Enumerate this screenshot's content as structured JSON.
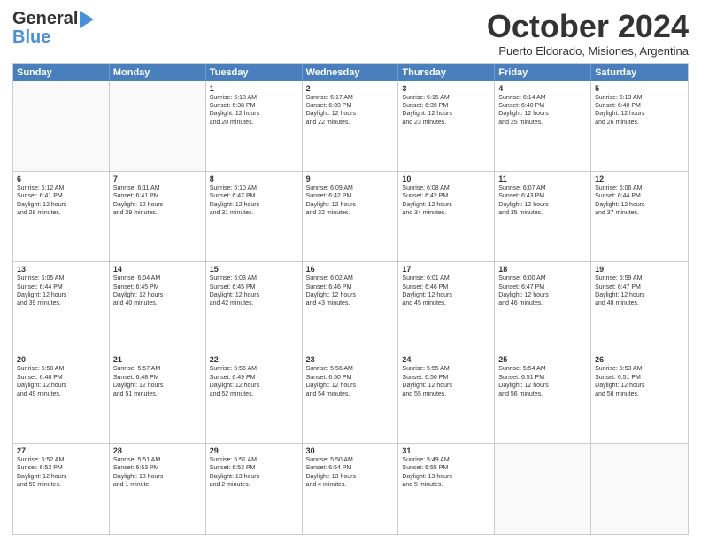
{
  "header": {
    "logo_line1": "General",
    "logo_line2": "Blue",
    "month_title": "October 2024",
    "subtitle": "Puerto Eldorado, Misiones, Argentina"
  },
  "days_of_week": [
    "Sunday",
    "Monday",
    "Tuesday",
    "Wednesday",
    "Thursday",
    "Friday",
    "Saturday"
  ],
  "weeks": [
    [
      {
        "day": "",
        "empty": true
      },
      {
        "day": "",
        "empty": true
      },
      {
        "day": "1",
        "sunrise": "6:18 AM",
        "sunset": "6:38 PM",
        "daylight": "12 hours and 20 minutes."
      },
      {
        "day": "2",
        "sunrise": "6:17 AM",
        "sunset": "6:39 PM",
        "daylight": "12 hours and 22 minutes."
      },
      {
        "day": "3",
        "sunrise": "6:15 AM",
        "sunset": "6:39 PM",
        "daylight": "12 hours and 23 minutes."
      },
      {
        "day": "4",
        "sunrise": "6:14 AM",
        "sunset": "6:40 PM",
        "daylight": "12 hours and 25 minutes."
      },
      {
        "day": "5",
        "sunrise": "6:13 AM",
        "sunset": "6:40 PM",
        "daylight": "12 hours and 26 minutes."
      }
    ],
    [
      {
        "day": "6",
        "sunrise": "6:12 AM",
        "sunset": "6:41 PM",
        "daylight": "12 hours and 28 minutes."
      },
      {
        "day": "7",
        "sunrise": "6:11 AM",
        "sunset": "6:41 PM",
        "daylight": "12 hours and 29 minutes."
      },
      {
        "day": "8",
        "sunrise": "6:10 AM",
        "sunset": "6:42 PM",
        "daylight": "12 hours and 31 minutes."
      },
      {
        "day": "9",
        "sunrise": "6:09 AM",
        "sunset": "6:42 PM",
        "daylight": "12 hours and 32 minutes."
      },
      {
        "day": "10",
        "sunrise": "6:08 AM",
        "sunset": "6:42 PM",
        "daylight": "12 hours and 34 minutes."
      },
      {
        "day": "11",
        "sunrise": "6:07 AM",
        "sunset": "6:43 PM",
        "daylight": "12 hours and 35 minutes."
      },
      {
        "day": "12",
        "sunrise": "6:06 AM",
        "sunset": "6:44 PM",
        "daylight": "12 hours and 37 minutes."
      }
    ],
    [
      {
        "day": "13",
        "sunrise": "6:05 AM",
        "sunset": "6:44 PM",
        "daylight": "12 hours and 39 minutes."
      },
      {
        "day": "14",
        "sunrise": "6:04 AM",
        "sunset": "6:45 PM",
        "daylight": "12 hours and 40 minutes."
      },
      {
        "day": "15",
        "sunrise": "6:03 AM",
        "sunset": "6:45 PM",
        "daylight": "12 hours and 42 minutes."
      },
      {
        "day": "16",
        "sunrise": "6:02 AM",
        "sunset": "6:46 PM",
        "daylight": "12 hours and 43 minutes."
      },
      {
        "day": "17",
        "sunrise": "6:01 AM",
        "sunset": "6:46 PM",
        "daylight": "12 hours and 45 minutes."
      },
      {
        "day": "18",
        "sunrise": "6:00 AM",
        "sunset": "6:47 PM",
        "daylight": "12 hours and 46 minutes."
      },
      {
        "day": "19",
        "sunrise": "5:59 AM",
        "sunset": "6:47 PM",
        "daylight": "12 hours and 48 minutes."
      }
    ],
    [
      {
        "day": "20",
        "sunrise": "5:58 AM",
        "sunset": "6:48 PM",
        "daylight": "12 hours and 49 minutes."
      },
      {
        "day": "21",
        "sunrise": "5:57 AM",
        "sunset": "6:48 PM",
        "daylight": "12 hours and 51 minutes."
      },
      {
        "day": "22",
        "sunrise": "5:56 AM",
        "sunset": "6:49 PM",
        "daylight": "12 hours and 52 minutes."
      },
      {
        "day": "23",
        "sunrise": "5:56 AM",
        "sunset": "6:50 PM",
        "daylight": "12 hours and 54 minutes."
      },
      {
        "day": "24",
        "sunrise": "5:55 AM",
        "sunset": "6:50 PM",
        "daylight": "12 hours and 55 minutes."
      },
      {
        "day": "25",
        "sunrise": "5:54 AM",
        "sunset": "6:51 PM",
        "daylight": "12 hours and 56 minutes."
      },
      {
        "day": "26",
        "sunrise": "5:53 AM",
        "sunset": "6:51 PM",
        "daylight": "12 hours and 58 minutes."
      }
    ],
    [
      {
        "day": "27",
        "sunrise": "5:52 AM",
        "sunset": "6:52 PM",
        "daylight": "12 hours and 59 minutes."
      },
      {
        "day": "28",
        "sunrise": "5:51 AM",
        "sunset": "6:53 PM",
        "daylight": "13 hours and 1 minute."
      },
      {
        "day": "29",
        "sunrise": "5:51 AM",
        "sunset": "6:53 PM",
        "daylight": "13 hours and 2 minutes."
      },
      {
        "day": "30",
        "sunrise": "5:50 AM",
        "sunset": "6:54 PM",
        "daylight": "13 hours and 4 minutes."
      },
      {
        "day": "31",
        "sunrise": "5:49 AM",
        "sunset": "6:55 PM",
        "daylight": "13 hours and 5 minutes."
      },
      {
        "day": "",
        "empty": true
      },
      {
        "day": "",
        "empty": true
      }
    ]
  ],
  "labels": {
    "sunrise": "Sunrise:",
    "sunset": "Sunset:",
    "daylight": "Daylight:"
  }
}
